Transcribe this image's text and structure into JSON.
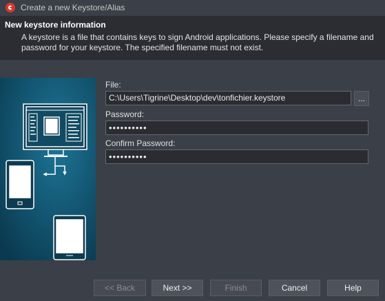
{
  "window": {
    "title": "Create a new Keystore/Alias",
    "icon": "app-logo-icon"
  },
  "header": {
    "title": "New keystore information",
    "description": "A keystore is a file that contains keys to sign Android applications. Please specify a filename and password for your keystore. The specified filename must not exist."
  },
  "form": {
    "file": {
      "label": "File:",
      "value": "C:\\Users\\Tigrine\\Desktop\\dev\\tonfichier.keystore"
    },
    "browse_label": "...",
    "password": {
      "label": "Password:",
      "value": "••••••••••"
    },
    "confirm_password": {
      "label": "Confirm Password:",
      "value": "••••••••••"
    }
  },
  "buttons": {
    "back": "<< Back",
    "next": "Next >>",
    "finish": "Finish",
    "cancel": "Cancel",
    "help": "Help"
  },
  "colors": {
    "background": "#3b3f47",
    "header": "#2b2d32",
    "illustration": "#0d4a63",
    "icon_red": "#d9362b"
  }
}
